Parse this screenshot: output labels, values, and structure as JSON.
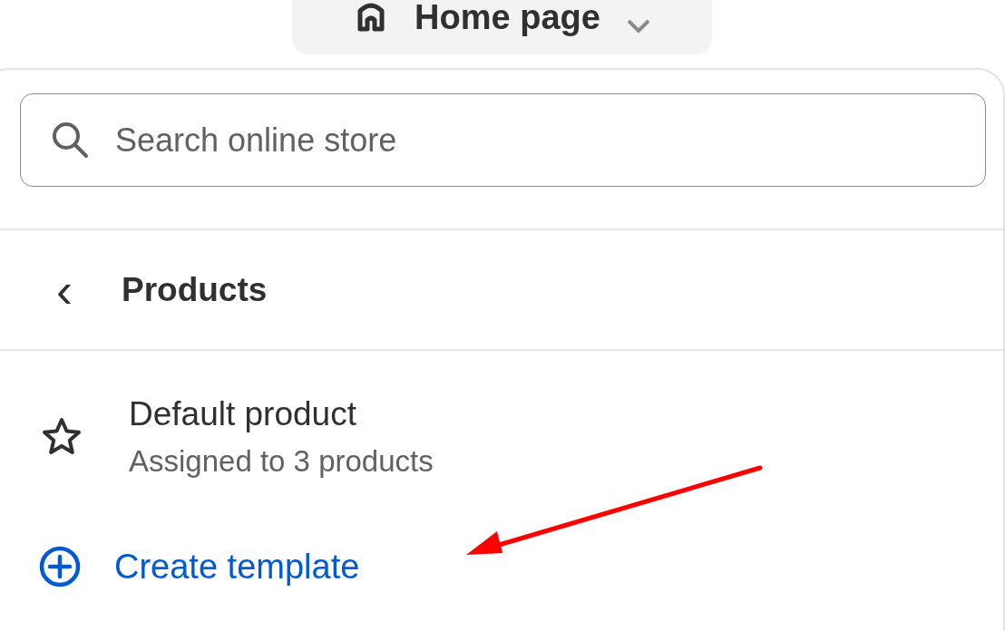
{
  "page_selector": {
    "label": "Home page"
  },
  "search": {
    "placeholder": "Search online store"
  },
  "header": {
    "back": "‹",
    "title": "Products"
  },
  "templates": [
    {
      "title": "Default product",
      "subtitle": "Assigned to 3 products"
    }
  ],
  "create_action": {
    "label": "Create template"
  }
}
